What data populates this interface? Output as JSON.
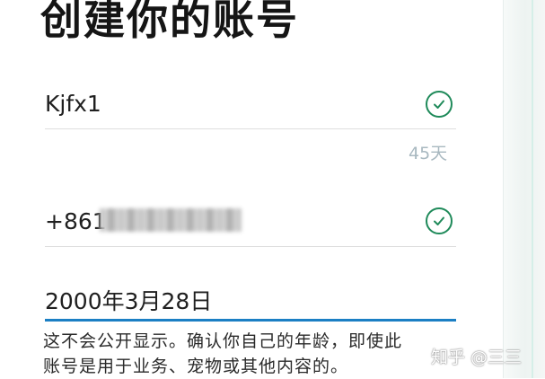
{
  "header": {
    "title": "创建你的账号"
  },
  "name_field": {
    "value": "Kjfx1",
    "status_icon": "check-circle-icon"
  },
  "counter": {
    "text": "45天"
  },
  "phone_field": {
    "value_prefix": "+861",
    "status_icon": "check-circle-icon"
  },
  "date_field": {
    "value": "2000年3月28日"
  },
  "note": {
    "line1": "这不会公开显示。确认你自己的年龄，即使此",
    "line2": "账号是用于业务、宠物或其他内容的。"
  },
  "watermark": {
    "text": "知乎 @三三"
  },
  "colors": {
    "accent_blue": "#1b7fc4",
    "check_green": "#1f8a5a",
    "counter_gray": "#a8b8c0"
  }
}
